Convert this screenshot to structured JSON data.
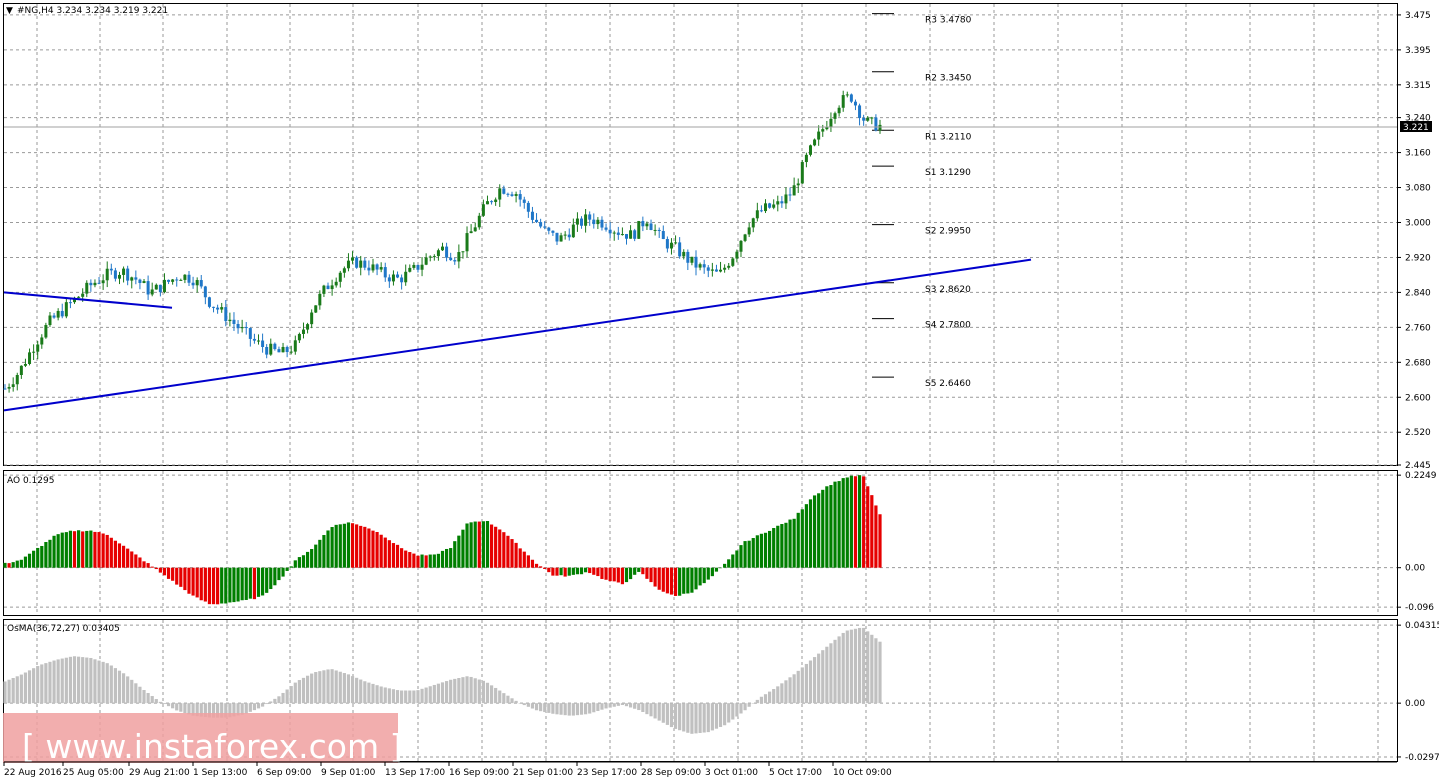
{
  "header": {
    "symbol_info": "#NG,H4  3.234 3.234 3.219 3.221",
    "menu_icon": "triangle-down-icon"
  },
  "watermark": {
    "text": "[ www.instaforex.com ]"
  },
  "colors": {
    "bull_candle": "#1a7a1a",
    "bear_candle": "#1f77c8",
    "trendline": "#0000cc",
    "ao_up": "#007f00",
    "ao_down": "#e60000",
    "osma": "#c0c0c0",
    "watermark_bg": "#f0a0a0"
  },
  "panels": {
    "ao_label": "AO 0.1295",
    "osma_label": "OsMA(36,72,27) 0.03405"
  },
  "chart_data": [
    {
      "type": "candlestick",
      "title": "#NG,H4",
      "ylim": [
        2.445,
        3.5
      ],
      "y_ticks": [
        "3.475",
        "3.395",
        "3.315",
        "3.240",
        "3.160",
        "3.080",
        "3.000",
        "2.920",
        "2.840",
        "2.760",
        "2.680",
        "2.600",
        "2.520",
        "2.445"
      ],
      "current_price": "3.221",
      "x_tick_labels": [
        "22 Aug 2016",
        "25 Aug 05:00",
        "29 Aug 21:00",
        "1 Sep 13:00",
        "6 Sep 09:00",
        "9 Sep 01:00",
        "13 Sep 17:00",
        "16 Sep 09:00",
        "21 Sep 01:00",
        "23 Sep 17:00",
        "28 Sep 09:00",
        "3 Oct 01:00",
        "5 Oct 17:00",
        "10 Oct 09:00"
      ],
      "close_series": [
        2.62,
        2.66,
        2.72,
        2.77,
        2.8,
        2.83,
        2.86,
        2.88,
        2.89,
        2.87,
        2.84,
        2.86,
        2.88,
        2.87,
        2.82,
        2.79,
        2.76,
        2.73,
        2.71,
        2.7,
        2.72,
        2.8,
        2.85,
        2.89,
        2.91,
        2.9,
        2.88,
        2.87,
        2.89,
        2.92,
        2.94,
        2.92,
        2.98,
        3.04,
        3.08,
        3.07,
        3.02,
        2.98,
        2.96,
        2.99,
        3.01,
        3.0,
        2.98,
        2.97,
        3.01,
        2.96,
        2.94,
        2.91,
        2.89,
        2.88,
        2.93,
        3.0,
        3.03,
        3.04,
        3.07,
        3.15,
        3.21,
        3.27,
        3.29,
        3.23,
        3.221
      ],
      "pivot_levels": [
        {
          "label": "R3 3.4780",
          "value": 3.478
        },
        {
          "label": "R2 3.3450",
          "value": 3.345
        },
        {
          "label": "R1 3.2110",
          "value": 3.211
        },
        {
          "label": "S1 3.1290",
          "value": 3.129
        },
        {
          "label": "S2 2.9950",
          "value": 2.995
        },
        {
          "label": "S3 2.8620",
          "value": 2.862
        },
        {
          "label": "S4 2.7800",
          "value": 2.78
        },
        {
          "label": "S5 2.6460",
          "value": 2.646
        }
      ],
      "trendlines": [
        {
          "from": {
            "x": "22 Aug 2016",
            "y": 2.57
          },
          "to": {
            "x": "11 Oct",
            "y": 2.915
          }
        },
        {
          "from": {
            "x": "22 Aug 2016",
            "y": 2.84
          },
          "to": {
            "x": "31 Aug",
            "y": 2.805
          }
        }
      ]
    },
    {
      "type": "bar",
      "title": "AO 0.1295",
      "ylim": [
        -0.115,
        0.235
      ],
      "y_ticks": [
        "0.2249",
        "0.00",
        "-0.096"
      ],
      "values": [
        0.01,
        0.02,
        0.05,
        0.08,
        0.09,
        0.09,
        0.08,
        0.05,
        0.02,
        -0.01,
        -0.04,
        -0.07,
        -0.09,
        -0.085,
        -0.08,
        -0.07,
        -0.03,
        0.02,
        0.05,
        0.1,
        0.11,
        0.1,
        0.08,
        0.05,
        0.03,
        0.03,
        0.05,
        0.11,
        0.115,
        0.09,
        0.05,
        0.01,
        -0.02,
        -0.02,
        -0.01,
        -0.03,
        -0.04,
        -0.01,
        -0.05,
        -0.07,
        -0.06,
        -0.03,
        0.01,
        0.06,
        0.08,
        0.1,
        0.12,
        0.17,
        0.2,
        0.22,
        0.2249,
        0.1295
      ]
    },
    {
      "type": "bar",
      "title": "OsMA(36,72,27) 0.03405",
      "ylim": [
        -0.032,
        0.046
      ],
      "y_ticks": [
        "0.04315",
        "0.00",
        "-0.02976"
      ],
      "values": [
        0.012,
        0.016,
        0.021,
        0.024,
        0.026,
        0.025,
        0.022,
        0.016,
        0.008,
        0.001,
        -0.004,
        -0.007,
        -0.008,
        -0.008,
        -0.006,
        -0.002,
        0.004,
        0.012,
        0.017,
        0.019,
        0.016,
        0.012,
        0.009,
        0.007,
        0.007,
        0.01,
        0.013,
        0.015,
        0.012,
        0.006,
        0.0,
        -0.004,
        -0.006,
        -0.007,
        -0.006,
        -0.003,
        -0.001,
        -0.004,
        -0.009,
        -0.014,
        -0.017,
        -0.016,
        -0.012,
        -0.005,
        0.003,
        0.009,
        0.016,
        0.024,
        0.032,
        0.04,
        0.042,
        0.034
      ]
    }
  ]
}
